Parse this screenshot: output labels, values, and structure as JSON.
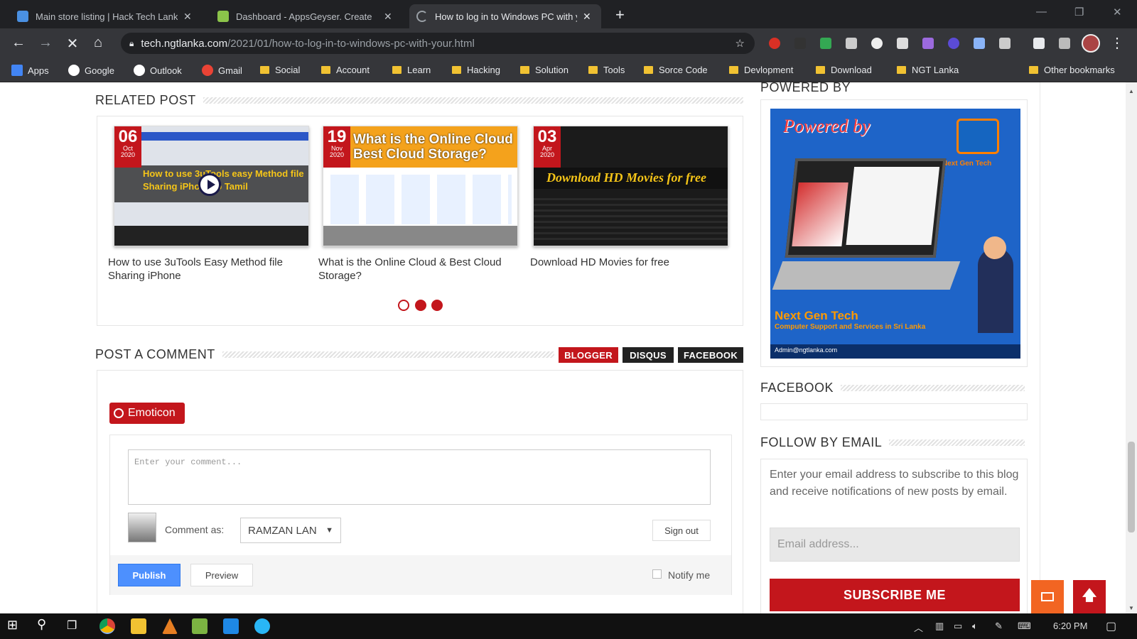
{
  "browser": {
    "tabs": [
      {
        "title": "Main store listing | Hack Tech Lanka",
        "favicon_color": "#4a90e2",
        "active": false
      },
      {
        "title": "Dashboard - AppsGeyser. Create",
        "favicon_color": "#8bc34a",
        "active": false
      },
      {
        "title": "How to log in to Windows PC with your",
        "favicon_color": "#9aa0a6",
        "active": true
      }
    ],
    "new_tab": "+",
    "window_controls": {
      "minimize": "—",
      "restore": "❐",
      "close": "✕"
    },
    "url_domain": "tech.ngtlanka.com",
    "url_path": "/2021/01/how-to-log-in-to-windows-pc-with-your.html",
    "bookmarks": [
      {
        "label": "Apps",
        "kind": "apps"
      },
      {
        "label": "Google",
        "kind": "google"
      },
      {
        "label": "Outlook",
        "kind": "outlook"
      },
      {
        "label": "Gmail",
        "kind": "gmail"
      },
      {
        "label": "Social",
        "kind": "folder"
      },
      {
        "label": "Account",
        "kind": "folder"
      },
      {
        "label": "Learn",
        "kind": "folder"
      },
      {
        "label": "Hacking",
        "kind": "folder"
      },
      {
        "label": "Solution",
        "kind": "folder"
      },
      {
        "label": "Tools",
        "kind": "folder"
      },
      {
        "label": "Sorce Code",
        "kind": "folder"
      },
      {
        "label": "Devlopment",
        "kind": "folder"
      },
      {
        "label": "Download",
        "kind": "folder"
      },
      {
        "label": "NGT Lanka",
        "kind": "folder"
      }
    ],
    "other_bookmarks": "Other bookmarks"
  },
  "related": {
    "title": "RELATED POST",
    "posts": [
      {
        "day": "06",
        "month": "Oct",
        "year": "2020",
        "title": "How to use 3uTools Easy Method file Sharing iPhone",
        "thumb_text": "How to use 3uTools easy Method file Sharing iPhone to Tamil"
      },
      {
        "day": "19",
        "month": "Nov",
        "year": "2020",
        "title": "What is the Online Cloud & Best Cloud Storage?",
        "thumb_text": "What is the Online Cloud Best Cloud Storage?"
      },
      {
        "day": "03",
        "month": "Apr",
        "year": "2020",
        "title": "Download HD Movies for free",
        "thumb_text": "Download HD Movies for free"
      }
    ]
  },
  "comment": {
    "title": "POST A COMMENT",
    "tabs": [
      "BLOGGER",
      "DISQUS",
      "FACEBOOK"
    ],
    "emoticon": "Emoticon",
    "placeholder": "Enter your comment...",
    "comment_as": "Comment as:",
    "account": "RAMZAN LAN",
    "sign_out": "Sign out",
    "publish": "Publish",
    "preview": "Preview",
    "notify": "Notify me"
  },
  "sidebar": {
    "powered_title": "POWERED BY",
    "ad": {
      "headline": "Powered by",
      "logo": "Next Gen Tech",
      "footer_title": "Next Gen Tech",
      "footer_sub": "Computer Support and Services in Sri Lanka",
      "contact": "Admin@ngtlanka.com"
    },
    "facebook_title": "FACEBOOK",
    "follow_title": "FOLLOW BY EMAIL",
    "follow_desc": "Enter your email address to subscribe to this blog and receive notifications of new posts by email.",
    "email_placeholder": "Email address...",
    "subscribe": "SUBSCRIBE ME"
  },
  "taskbar": {
    "time": "6:20 PM"
  },
  "colors": {
    "brand_red": "#c3161c",
    "chrome_dark": "#202124",
    "chrome_toolbar": "#35363a",
    "publish_blue": "#4d90fe",
    "float_orange": "#f26522"
  }
}
